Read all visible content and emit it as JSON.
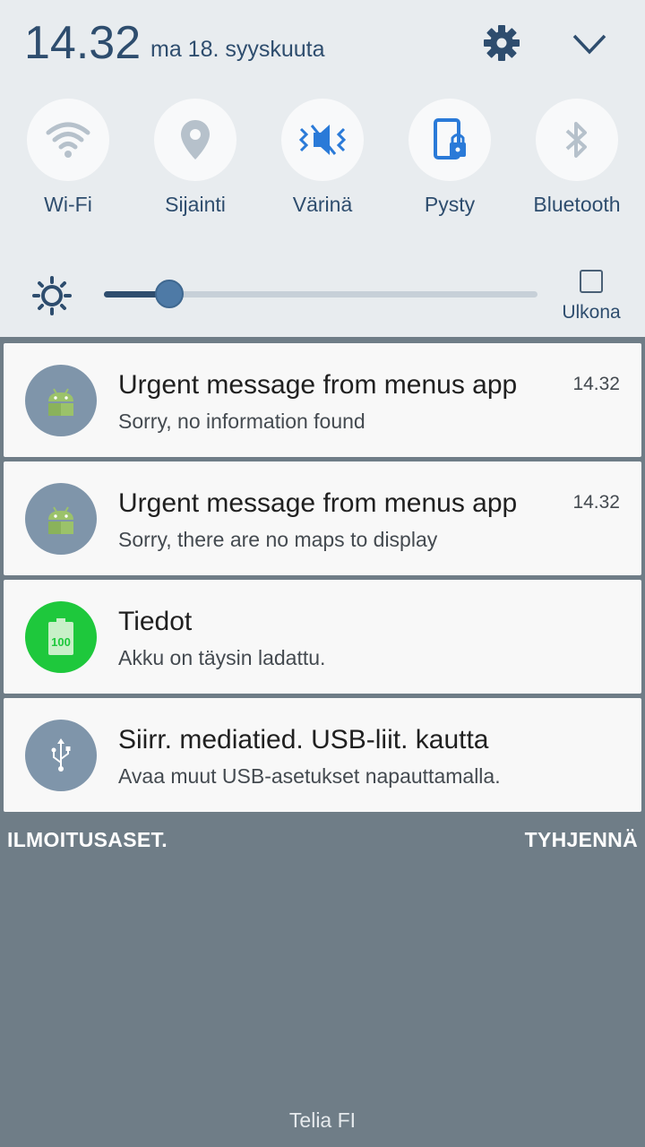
{
  "header": {
    "time": "14.32",
    "date": "ma 18. syyskuuta"
  },
  "quick_settings": [
    {
      "label": "Wi-Fi",
      "icon": "wifi-icon",
      "state": "off"
    },
    {
      "label": "Sijainti",
      "icon": "location-icon",
      "state": "off"
    },
    {
      "label": "Värinä",
      "icon": "vibrate-icon",
      "state": "on"
    },
    {
      "label": "Pysty",
      "icon": "rotation-lock-icon",
      "state": "on"
    },
    {
      "label": "Bluetooth",
      "icon": "bluetooth-icon",
      "state": "off"
    }
  ],
  "brightness": {
    "level": 0.15,
    "outdoor_label": "Ulkona",
    "outdoor_checked": false
  },
  "notifications": [
    {
      "title": "Urgent message from menus app",
      "subtitle": "Sorry, no information found",
      "time": "14.32",
      "icon": "android-icon"
    },
    {
      "title": "Urgent message from menus app",
      "subtitle": "Sorry, there are no maps to display",
      "time": "14.32",
      "icon": "android-icon"
    },
    {
      "title": "Tiedot",
      "subtitle": "Akku on täysin ladattu.",
      "time": "",
      "icon": "battery-full-icon",
      "icon_text": "100"
    },
    {
      "title": "Siirr. mediatied. USB-liit. kautta",
      "subtitle": "Avaa muut USB-asetukset napauttamalla.",
      "time": "",
      "icon": "usb-icon"
    }
  ],
  "actions": {
    "settings_label": "ILMOITUSASET.",
    "clear_label": "TYHJENNÄ"
  },
  "carrier": "Telia FI",
  "colors": {
    "accent": "#2e4d6e",
    "active_icon": "#2a7ad8",
    "inactive_icon": "#b6c1cb",
    "android_icon_bg": "#7f95aa",
    "battery_icon_bg": "#1ec83c",
    "shade_bg": "#6f7d87"
  }
}
